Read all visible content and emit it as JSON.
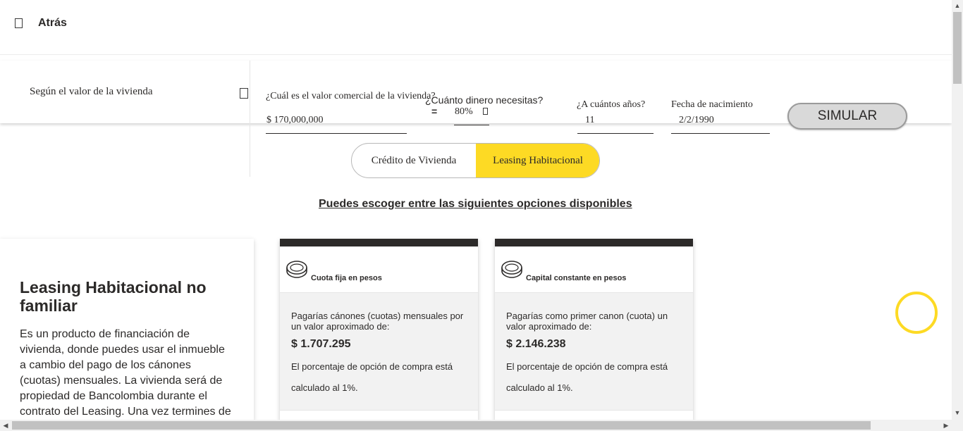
{
  "header": {
    "back_label": "Atrás"
  },
  "simulator": {
    "mode_label": "Según el valor de la vivienda",
    "property_value_label": "¿Cuál es el valor comercial de la vivienda?",
    "property_value": "$ 170,000,000",
    "equals_sign": "=",
    "amount_needed_label": "¿Cuánto dinero necesitas?",
    "amount_needed_value": "80%",
    "years_label": "¿A cuántos años?",
    "years_value": "11",
    "birthdate_label": "Fecha de nacimiento",
    "birthdate_value": "2/2/1990",
    "simulate_button": "SIMULAR"
  },
  "product_toggle": {
    "options": [
      "Crédito de Vivienda",
      "Leasing Habitacional"
    ],
    "selected": "Leasing Habitacional",
    "selected_color": "#fdda24"
  },
  "options_heading": "Puedes escoger entre las siguientes opciones disponibles",
  "info_card": {
    "title": "Leasing Habitacional no familiar",
    "text": "Es un producto de financiación de vivienda, donde puedes usar el inmueble a cambio del pago de los cánones (cuotas) mensuales. La vivienda será de propiedad de Bancolombia durante el contrato del Leasing. Una vez termines de cancelar los"
  },
  "option_cards": [
    {
      "name": "Cuota fija en pesos",
      "icon": "coin-icon",
      "description": "Pagarías cánones (cuotas) mensuales por un valor aproximado de:",
      "amount": "$ 1.707.295",
      "note": "El porcentaje de opción de compra está calculado al 1%."
    },
    {
      "name": "Capital constante en pesos",
      "icon": "coin-icon",
      "description": "Pagarías como primer canon (cuota) un valor aproximado de:",
      "amount": "$ 2.146.238",
      "note": "El porcentaje de opción de compra está calculado al 1%."
    }
  ],
  "colors": {
    "accent": "#fdda24",
    "text": "#2c2a29"
  }
}
